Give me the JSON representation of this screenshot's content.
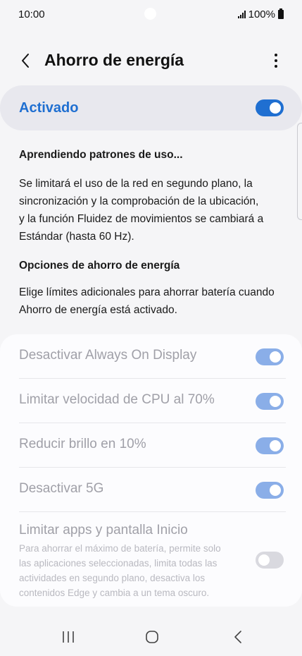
{
  "status_bar": {
    "time": "10:00",
    "battery_text": "100%"
  },
  "header": {
    "title": "Ahorro de energía"
  },
  "master_toggle": {
    "label": "Activado",
    "state": "on"
  },
  "info": {
    "learning_heading": "Aprendiendo patrones de uso...",
    "learning_line_1": "Se limitará el uso de la red en segundo plano, la",
    "learning_line_2": "sincronización y la comprobación de la ubicación,",
    "learning_line_3": "y la función Fluidez de movimientos se cambiará a",
    "learning_line_4": "Estándar (hasta 60 Hz).",
    "options_heading": "Opciones de ahorro de energía",
    "options_line_1": "Elige límites adicionales para ahorrar batería cuando",
    "options_line_2": "Ahorro de energía está activado."
  },
  "options": [
    {
      "label": "Desactivar Always On Display",
      "state": "on"
    },
    {
      "label": "Limitar velocidad de CPU al 70%",
      "state": "on"
    },
    {
      "label": "Reducir brillo en 10%",
      "state": "on"
    },
    {
      "label": "Desactivar 5G",
      "state": "on"
    },
    {
      "label": "Limitar apps y pantalla Inicio",
      "state": "off",
      "desc_line_1": "Para ahorrar el máximo de batería, permite solo",
      "desc_line_2": "las aplicaciones seleccionadas, limita todas las",
      "desc_line_3": "actividades en segundo plano, desactiva los",
      "desc_line_4": "contenidos Edge y cambia a un tema oscuro."
    }
  ],
  "colors": {
    "accent": "#1f6fd1",
    "accent_dim": "#8aaee8",
    "disabled_text": "#a0a0a8"
  },
  "icons": [
    "back-arrow-icon",
    "more-vert-icon",
    "recents-icon",
    "home-icon",
    "back-nav-icon"
  ]
}
